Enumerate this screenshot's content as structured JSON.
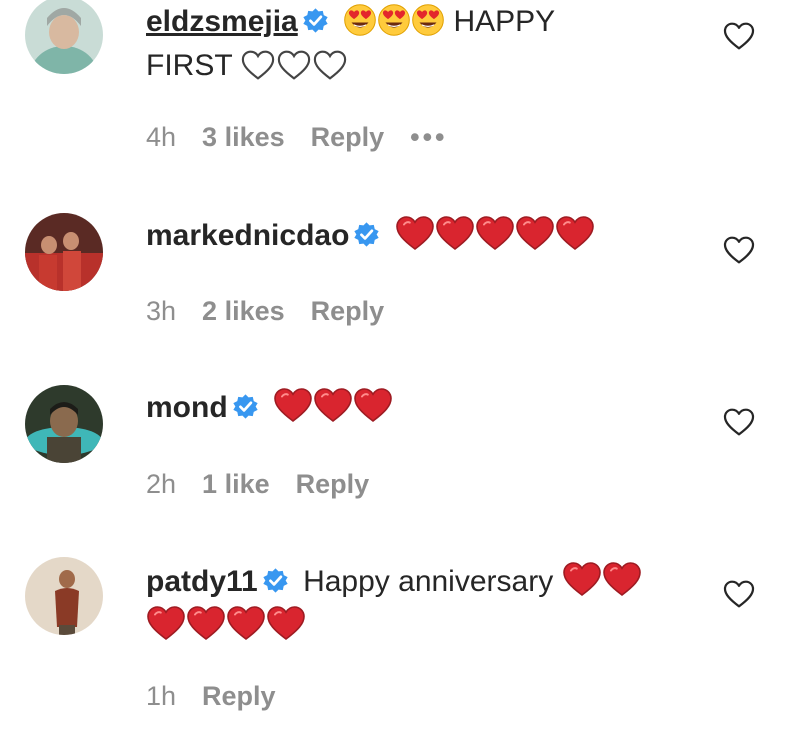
{
  "colors": {
    "verified": "#3897f0",
    "heart": "#d9252f",
    "meta": "#8e8e8e",
    "text": "#262626"
  },
  "comments": [
    {
      "username": "eldzsmejia",
      "text_parts": [
        "HAPPY",
        "FIRST"
      ],
      "emojis": [
        "heart-eyes-emoji",
        "heart-eyes-emoji",
        "heart-eyes-emoji",
        "white-heart-emoji",
        "white-heart-emoji",
        "white-heart-emoji"
      ],
      "time": "4h",
      "likes": "3 likes",
      "reply": "Reply",
      "more": "•••"
    },
    {
      "username": "markednicdao",
      "emojis": [
        "red-heart-emoji",
        "red-heart-emoji",
        "red-heart-emoji",
        "red-heart-emoji",
        "red-heart-emoji"
      ],
      "time": "3h",
      "likes": "2 likes",
      "reply": "Reply"
    },
    {
      "username": "mond",
      "emojis": [
        "red-heart-emoji",
        "red-heart-emoji",
        "red-heart-emoji"
      ],
      "time": "2h",
      "likes": "1 like",
      "reply": "Reply"
    },
    {
      "username": "patdy11",
      "text": "Happy anniversary",
      "emojis": [
        "red-heart-emoji",
        "red-heart-emoji",
        "red-heart-emoji",
        "red-heart-emoji",
        "red-heart-emoji",
        "red-heart-emoji"
      ],
      "time": "1h",
      "reply": "Reply"
    }
  ],
  "icons": {
    "like": "heart-outline-icon",
    "verified": "verified-badge-icon"
  }
}
